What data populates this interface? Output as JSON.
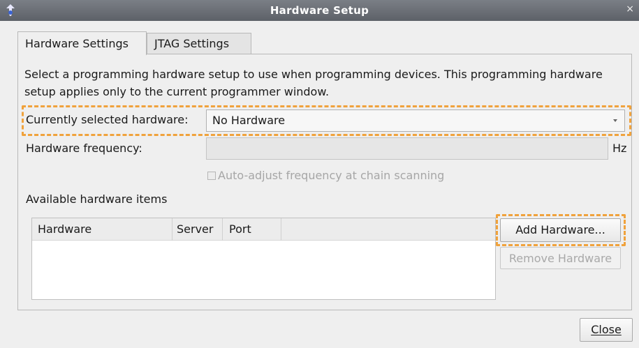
{
  "window": {
    "title": "Hardware Setup",
    "close_glyph": "×"
  },
  "tabs": [
    {
      "label": "Hardware Settings",
      "active": true
    },
    {
      "label": "JTAG Settings",
      "active": false
    }
  ],
  "description": "Select a programming hardware setup to use when programming devices. This programming hardware setup applies only to the current programmer window.",
  "selected_hardware": {
    "label": "Currently selected hardware:",
    "value": "No Hardware"
  },
  "frequency": {
    "label": "Hardware frequency:",
    "value": "",
    "unit": "Hz"
  },
  "auto_adjust": {
    "label": "Auto-adjust frequency at chain scanning",
    "checked": false,
    "enabled": false
  },
  "available": {
    "label": "Available hardware items",
    "columns": [
      "Hardware",
      "Server",
      "Port"
    ],
    "rows": []
  },
  "buttons": {
    "add_hardware": "Add Hardware...",
    "remove_hardware": "Remove Hardware",
    "close": "Close"
  },
  "colors": {
    "highlight": "#f0a23c",
    "titlebar": "#5d6168"
  },
  "icons": {
    "app": "quartus-app-icon",
    "close": "close-icon",
    "dropdown": "chevron-down-icon",
    "checkbox": "checkbox-icon"
  }
}
